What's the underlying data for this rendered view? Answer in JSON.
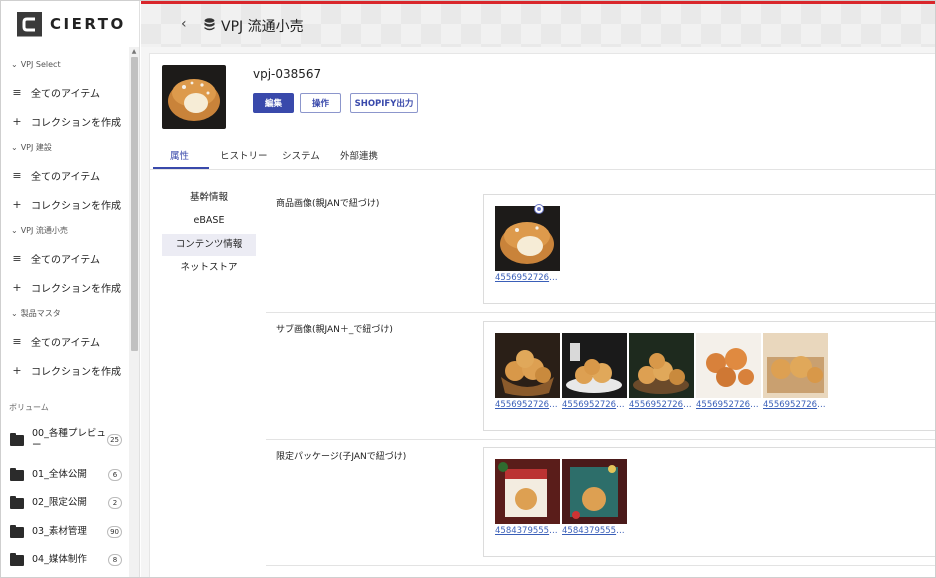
{
  "app": {
    "logo_text": "CIERTO",
    "logo_letter": "C"
  },
  "sidebar": {
    "groups": [
      {
        "label": "VPJ Select",
        "items": [
          {
            "label": "全てのアイテム",
            "icon": "database-icon"
          },
          {
            "label": "コレクションを作成",
            "icon": "plus-icon"
          }
        ]
      },
      {
        "label": "VPJ 建設",
        "items": [
          {
            "label": "全てのアイテム",
            "icon": "database-icon"
          },
          {
            "label": "コレクションを作成",
            "icon": "plus-icon"
          }
        ]
      },
      {
        "label": "VPJ 流通小売",
        "items": [
          {
            "label": "全てのアイテム",
            "icon": "database-icon"
          },
          {
            "label": "コレクションを作成",
            "icon": "plus-icon"
          }
        ]
      },
      {
        "label": "製品マスタ",
        "items": [
          {
            "label": "全てのアイテム",
            "icon": "database-icon"
          },
          {
            "label": "コレクションを作成",
            "icon": "plus-icon"
          }
        ]
      }
    ],
    "volume_label": "ボリューム",
    "volumes": [
      {
        "name": "00_各種プレビュー",
        "count": "25"
      },
      {
        "name": "01_全体公開",
        "count": "6"
      },
      {
        "name": "02_限定公開",
        "count": "2"
      },
      {
        "name": "03_素材管理",
        "count": "90"
      },
      {
        "name": "04_媒体制作",
        "count": "8"
      }
    ]
  },
  "header": {
    "title": "VPJ 流通小売",
    "back_icon": "chevron-left-icon",
    "title_icon": "database-icon"
  },
  "item": {
    "code": "vpj-038567",
    "buttons": {
      "edit": "編集",
      "operation": "操作",
      "shopify": "SHOPIFY出力"
    }
  },
  "tabs": [
    {
      "label": "属性"
    },
    {
      "label": "ヒストリー"
    },
    {
      "label": "システム"
    },
    {
      "label": "外部連携"
    }
  ],
  "subnav": [
    {
      "label": "基幹情報"
    },
    {
      "label": "eBASE"
    },
    {
      "label": "コンテンツ情報"
    },
    {
      "label": "ネットストア"
    }
  ],
  "fields": [
    {
      "label": "商品画像(親JANで紐づけ)",
      "images": [
        "455695272633.jpg"
      ],
      "link_texts": [
        "45569527263..."
      ]
    },
    {
      "label": "サブ画像(親JAN＋_で紐づけ)",
      "link_texts": [
        "45569527263...",
        "45569527263...",
        "45569527263...",
        "45569527263...",
        "45569527263..."
      ]
    },
    {
      "label": "限定パッケージ(子JANで紐づけ)",
      "link_texts": [
        "45843795558...",
        "45843795558..."
      ]
    }
  ],
  "colors": {
    "accent": "#3949ab",
    "header_stripe": "#d9262b",
    "link": "#3a5fb8"
  }
}
